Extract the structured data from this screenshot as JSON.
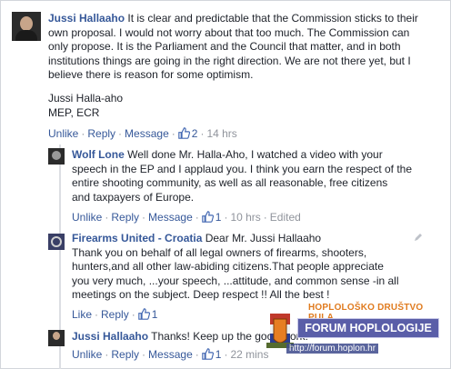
{
  "comments": [
    {
      "author": "Jussi Hallaaho",
      "lines": [
        "It is clear and predictable that the Commission sticks to their",
        "own proposal. I would not worry about that too much. The Commission can",
        "only propose. It is the Parliament and the Council that matter, and in both",
        "institutions things are going in the right direction. We are not there yet, but I",
        "believe there is reason for some optimism."
      ],
      "signature": [
        "Jussi Halla-aho",
        "MEP, ECR"
      ],
      "actions": {
        "like": "Unlike",
        "reply": "Reply",
        "message": "Message",
        "likes": "2",
        "time": "14 hrs"
      }
    },
    {
      "author": "Wolf Lone",
      "lines": [
        "Well done Mr. Halla-Aho, I watched a video with your",
        "speech in the EP and I applaud you. I think you earn the respect of the",
        "entire shooting community, as well as all reasonable, free citizens",
        "and taxpayers of Europe."
      ],
      "actions": {
        "like": "Unlike",
        "reply": "Reply",
        "message": "Message",
        "likes": "1",
        "time": "10 hrs",
        "edited": "Edited"
      }
    },
    {
      "author": "Firearms United - Croatia",
      "lines": [
        "Dear Mr. Jussi Hallaaho",
        "Thank you on behalf of all legal owners of firearms, shooters,",
        "hunters,and all other law-abiding citizens.That people appreciate",
        "you very much, ...your speech, ...attitude, and common sense -in all",
        "meetings on the subject. Deep respect !! All the best !"
      ],
      "actions": {
        "like": "Like",
        "reply": "Reply",
        "likes": "1"
      }
    },
    {
      "author": "Jussi Hallaaho",
      "lines": [
        "Thanks! Keep up the good work!"
      ],
      "actions": {
        "like": "Unlike",
        "reply": "Reply",
        "message": "Message",
        "likes": "1",
        "time": "22 mins"
      }
    }
  ],
  "watermark": {
    "org": "HOPLOLOŠKO DRUŠTVO PULA",
    "banner": "FORUM HOPLOLOGIJE",
    "url": "http://forum.hoplon.hr"
  },
  "colors": {
    "link": "#365899",
    "meta": "#90949c",
    "watermark_orange": "#e07b1f",
    "watermark_banner": "#5a5ea8"
  },
  "icons": [
    "thumbs-up-icon",
    "pencil-icon"
  ]
}
